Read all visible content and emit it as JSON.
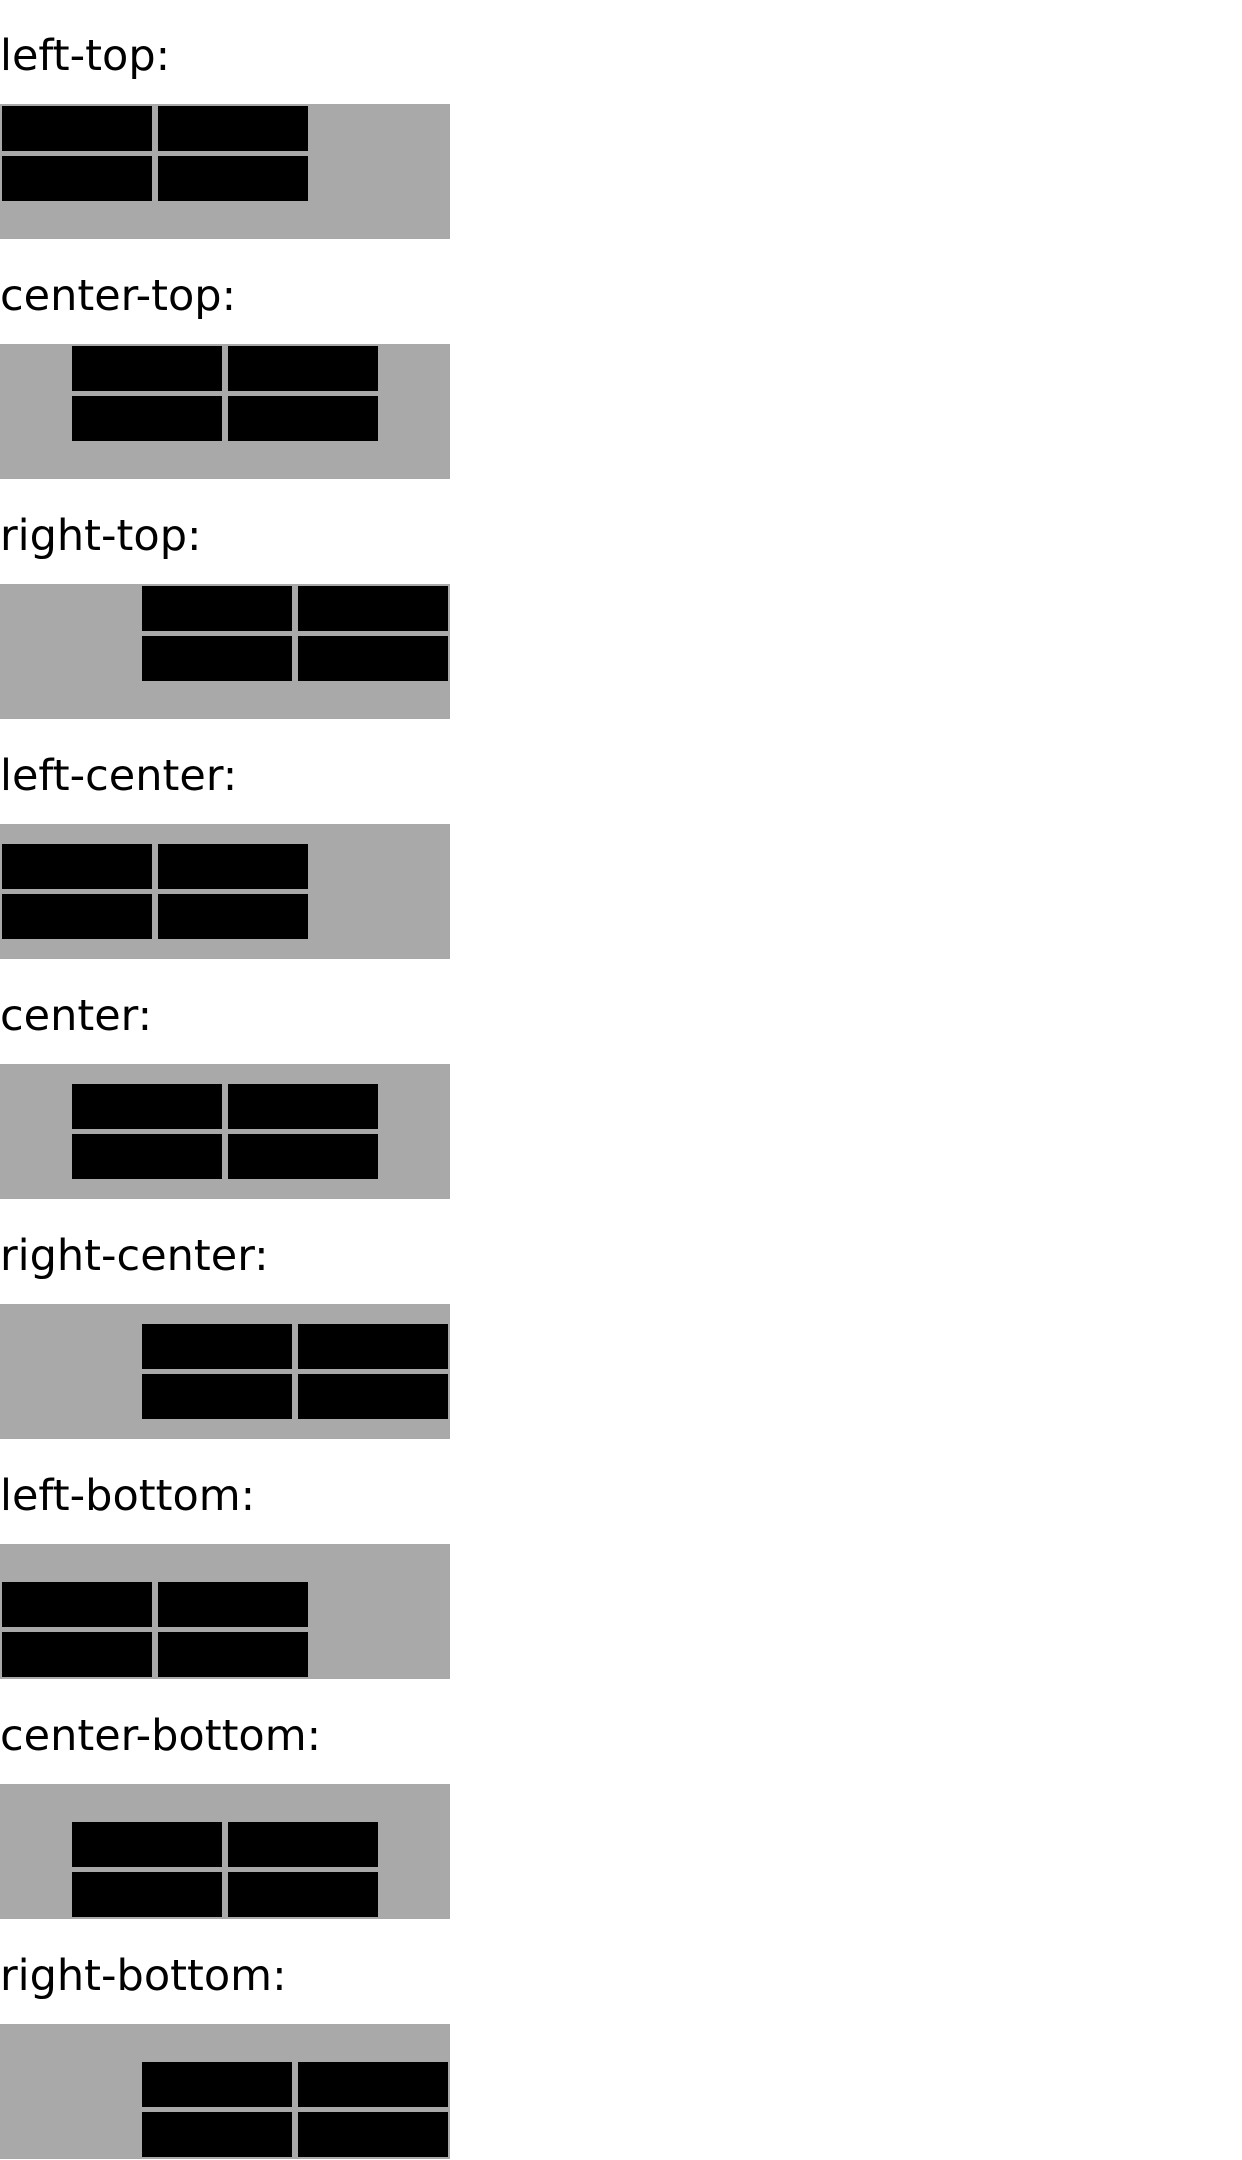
{
  "colors": {
    "page_background": "#ffffff",
    "container_background": "#a9a9a9",
    "cell_fill": "#000000",
    "text": "#000000"
  },
  "demos": [
    {
      "label": "left-top:",
      "h": "flex-start",
      "v": "flex-start"
    },
    {
      "label": "center-top:",
      "h": "center",
      "v": "flex-start"
    },
    {
      "label": "right-top:",
      "h": "flex-end",
      "v": "flex-start"
    },
    {
      "label": "left-center:",
      "h": "flex-start",
      "v": "center"
    },
    {
      "label": "center:",
      "h": "center",
      "v": "center"
    },
    {
      "label": "right-center:",
      "h": "flex-end",
      "v": "center"
    },
    {
      "label": "left-bottom:",
      "h": "flex-start",
      "v": "flex-end"
    },
    {
      "label": "center-bottom:",
      "h": "center",
      "v": "flex-end"
    },
    {
      "label": "right-bottom:",
      "h": "flex-end",
      "v": "flex-end"
    }
  ]
}
